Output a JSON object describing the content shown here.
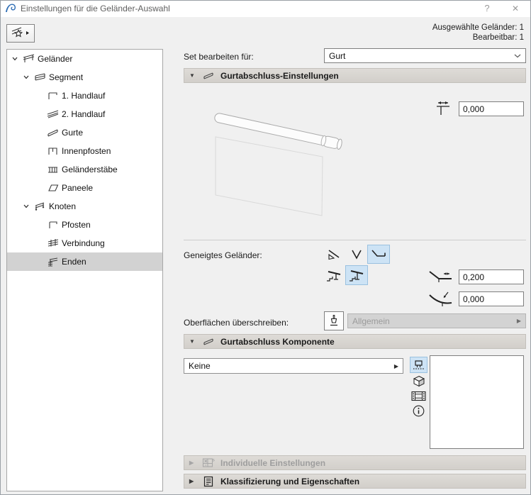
{
  "colors": {
    "selection_blue": "#cde3f5",
    "logo_blue": "#2e6db4",
    "tree_selected_gray": "#d2d2d2"
  },
  "icons": {
    "expanded": "▼",
    "collapsed": "▶",
    "popup": "▶",
    "combo_chevron": "⌄"
  },
  "window": {
    "title": "Einstellungen für die Geländer-Auswahl",
    "help_glyph": "?",
    "close_glyph": "✕"
  },
  "summary": {
    "selected": "Ausgewählte Geländer: 1",
    "editable": "Bearbeitbar: 1"
  },
  "tree": {
    "items": [
      {
        "label": "Geländer",
        "level": 0,
        "expanded": true
      },
      {
        "label": "Segment",
        "level": 1,
        "expanded": true
      },
      {
        "label": "1. Handlauf",
        "level": 2
      },
      {
        "label": "2. Handlauf",
        "level": 2
      },
      {
        "label": "Gurte",
        "level": 2
      },
      {
        "label": "Innenpfosten",
        "level": 2
      },
      {
        "label": "Geländerstäbe",
        "level": 2
      },
      {
        "label": "Paneele",
        "level": 2
      },
      {
        "label": "Knoten",
        "level": 1,
        "expanded": true
      },
      {
        "label": "Pfosten",
        "level": 2
      },
      {
        "label": "Verbindung",
        "level": 2
      },
      {
        "label": "Enden",
        "level": 2,
        "selected": true
      }
    ]
  },
  "editor": {
    "set_label": "Set bearbeiten für:",
    "set_value": "Gurt",
    "section_end_settings": "Gurtabschluss-Einstellungen",
    "end_offset_value": "0,000",
    "sloped_label": "Geneigtes Geländer:",
    "extension_value": "0,200",
    "radius_value": "0,000",
    "surface_label": "Oberflächen überschreiben:",
    "surface_value": "Allgemein",
    "section_end_component": "Gurtabschluss Komponente",
    "component_value": "Keine",
    "section_custom": "Individuelle Einstellungen",
    "section_classification": "Klassifizierung und Eigenschaften"
  }
}
